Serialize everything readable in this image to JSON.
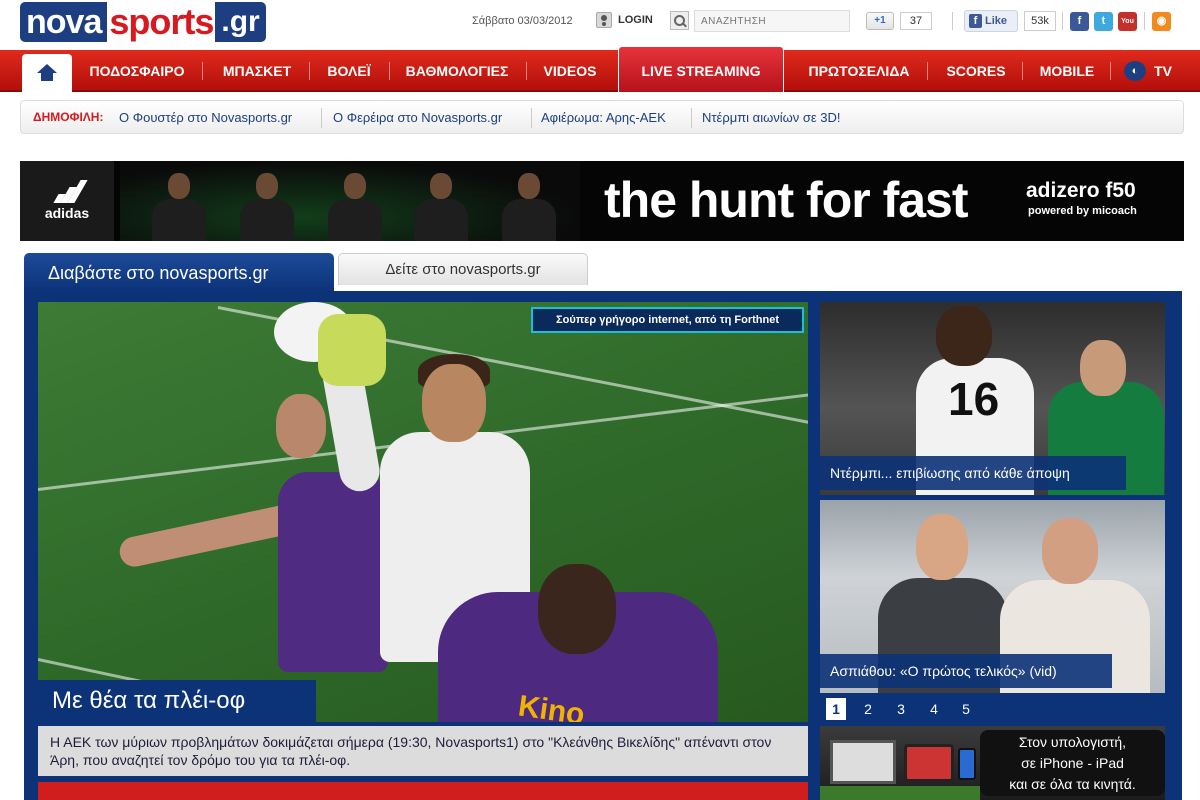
{
  "header": {
    "logo": {
      "part1": "nova",
      "part2": "sports",
      "part3": ".gr"
    },
    "date": "Σάββατο 03/03/2012",
    "login_label": "LOGIN",
    "search_placeholder": "ΑΝΑΖΗΤΗΣΗ",
    "gplus_label": "+1",
    "gplus_count": "37",
    "fb_like_label": "Like",
    "fb_count": "53k",
    "social_icons": [
      "facebook-icon",
      "twitter-icon",
      "youtube-icon",
      "rss-icon"
    ]
  },
  "nav": {
    "home_icon": "home-icon",
    "items": [
      "ΠΟΔΟΣΦΑΙΡΟ",
      "ΜΠΑΣΚΕΤ",
      "ΒΟΛΕΪ",
      "ΒΑΘΜΟΛΟΓΙΕΣ",
      "VIDEOS",
      "LIVE STREAMING",
      "ΠΡΩΤΟΣΕΛΙΔΑ",
      "SCORES",
      "MOBILE",
      "TV"
    ]
  },
  "popular": {
    "label": "ΔΗΜΟΦΙΛΗ:",
    "links": [
      "Ο Φουστέρ στο Novasports.gr",
      "Ο Φερέιρα στο Novasports.gr",
      "Αφιέρωμα: Αρης-ΑΕΚ",
      "Ντέρμπι αιωνίων σε 3D!"
    ]
  },
  "banner": {
    "brand": "adidas",
    "slogan": "the hunt for fast",
    "product": "adizero f50",
    "powered_by": "powered by micoach"
  },
  "tabs": {
    "active": "Διαβάστε στο novasports.gr",
    "inactive": "Δείτε στο novasports.gr"
  },
  "main_story": {
    "promo": "Σούπερ γρήγορο internet, από τη Forthnet",
    "shirt_text": "Kino",
    "headline": "Με θέα τα πλέι-οφ",
    "summary": "Η ΑΕΚ των μύριων προβλημάτων δοκιμάζεται σήμερα (19:30, Novasports1) στο \"Κλεάνθης Βικελίδης\" απέναντι στον Άρη, που αναζητεί τον δρόμο του για τα πλέι-οφ."
  },
  "side_stories": [
    {
      "caption": "Ντέρμπι... επιβίωσης από κάθε άποψη",
      "shirt_number": "16"
    },
    {
      "caption": "Ασπιάθου: «Ο πρώτος τελικός» (vid)"
    }
  ],
  "pager": {
    "pages": [
      "1",
      "2",
      "3",
      "4",
      "5"
    ],
    "active": "1"
  },
  "mobile_ad": {
    "line1": "Στον υπολογιστή,",
    "line2": "σε iPhone - iPad",
    "line3": "και σε όλα τα κινητά."
  },
  "colors": {
    "brand_blue": "#1d3f82",
    "brand_red": "#d71920",
    "panel_blue": "#0c3278",
    "promo_border": "#1bbfd8"
  }
}
